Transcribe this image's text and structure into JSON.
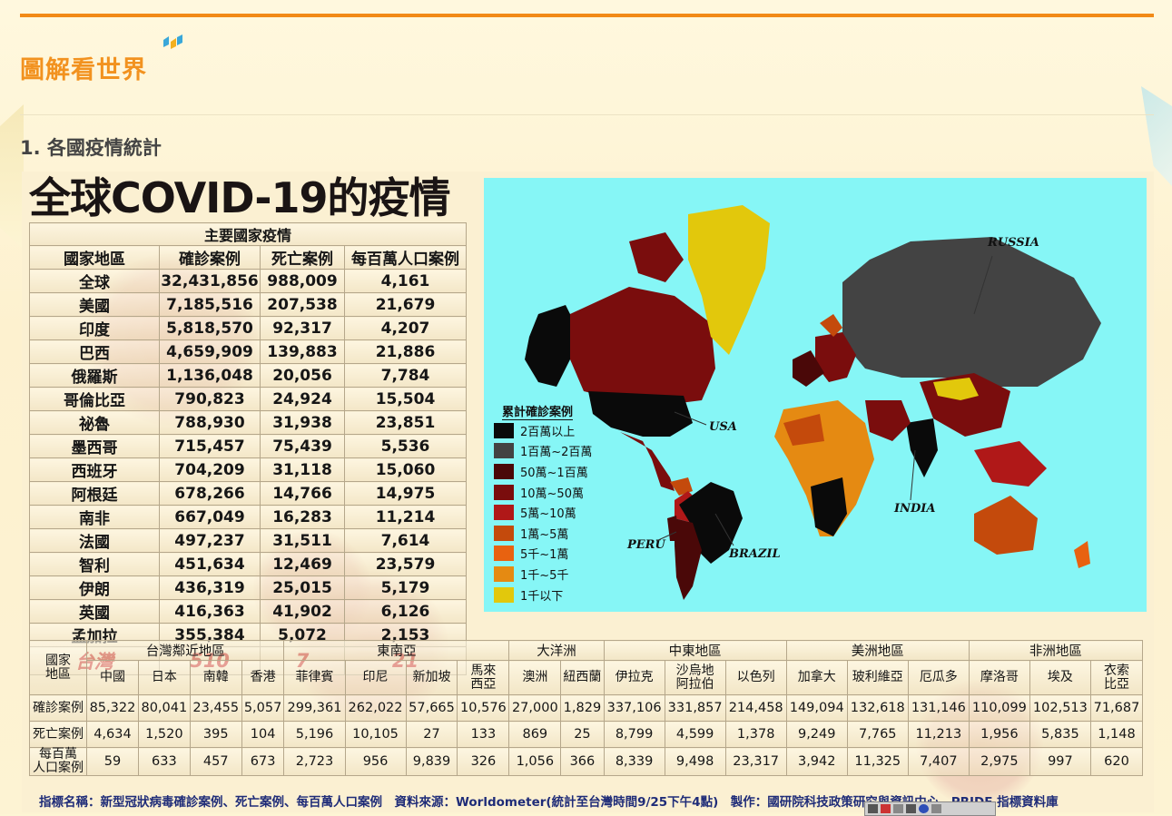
{
  "site": {
    "title": "圖解看世界"
  },
  "section": {
    "title": "1. 各國疫情統計"
  },
  "infographic": {
    "title": "全球COVID-19的疫情",
    "main_table": {
      "group_header": "主要國家疫情",
      "headers": [
        "國家地區",
        "確診案例",
        "死亡案例",
        "每百萬人口案例"
      ],
      "rows": [
        [
          "全球",
          "32,431,856",
          "988,009",
          "4,161"
        ],
        [
          "美國",
          "7,185,516",
          "207,538",
          "21,679"
        ],
        [
          "印度",
          "5,818,570",
          "92,317",
          "4,207"
        ],
        [
          "巴西",
          "4,659,909",
          "139,883",
          "21,886"
        ],
        [
          "俄羅斯",
          "1,136,048",
          "20,056",
          "7,784"
        ],
        [
          "哥倫比亞",
          "790,823",
          "24,924",
          "15,504"
        ],
        [
          "祕魯",
          "788,930",
          "31,938",
          "23,851"
        ],
        [
          "墨西哥",
          "715,457",
          "75,439",
          "5,536"
        ],
        [
          "西班牙",
          "704,209",
          "31,118",
          "15,060"
        ],
        [
          "阿根廷",
          "678,266",
          "14,766",
          "14,975"
        ],
        [
          "南非",
          "667,049",
          "16,283",
          "11,214"
        ],
        [
          "法國",
          "497,237",
          "31,511",
          "7,614"
        ],
        [
          "智利",
          "451,634",
          "12,469",
          "23,579"
        ],
        [
          "伊朗",
          "436,319",
          "25,015",
          "5,179"
        ],
        [
          "英國",
          "416,363",
          "41,902",
          "6,126"
        ],
        [
          "孟加拉",
          "355,384",
          "5,072",
          "2,153"
        ]
      ],
      "highlight_row": [
        "台灣",
        "510",
        "7",
        "21"
      ]
    },
    "map": {
      "legend_title": "累計確診案例",
      "legend": [
        {
          "label": "2百萬以上",
          "color": "#0a0a0a"
        },
        {
          "label": "1百萬~2百萬",
          "color": "#434343"
        },
        {
          "label": "50萬~1百萬",
          "color": "#4a0808"
        },
        {
          "label": "10萬~50萬",
          "color": "#7a0d0d"
        },
        {
          "label": "5萬~10萬",
          "color": "#b01818"
        },
        {
          "label": "1萬~5萬",
          "color": "#c44a0c"
        },
        {
          "label": "5千~1萬",
          "color": "#e86210"
        },
        {
          "label": "1千~5千",
          "color": "#e58a12"
        },
        {
          "label": "1千以下",
          "color": "#e2c80c"
        }
      ],
      "labels": {
        "russia": "RUSSIA",
        "usa": "USA",
        "india": "INDIA",
        "peru": "PERU",
        "brazil": "BRAZIL"
      },
      "colors": {
        "ocean": "#86f6f6",
        "greenland": "#e2c80c"
      }
    },
    "regional_table": {
      "row_label_header": "國家\n地區",
      "regions": [
        {
          "name": "台灣鄰近地區",
          "span": 4
        },
        {
          "name": "東南亞",
          "span": 4
        },
        {
          "name": "大洋洲",
          "span": 2
        },
        {
          "name": "中東地區",
          "span": 3
        },
        {
          "name": "美洲地區",
          "span": 3
        },
        {
          "name": "非洲地區",
          "span": 3
        }
      ],
      "countries": [
        "中國",
        "日本",
        "南韓",
        "香港",
        "菲律賓",
        "印尼",
        "新加坡",
        "馬來\n西亞",
        "澳洲",
        "紐西蘭",
        "伊拉克",
        "沙烏地\n阿拉伯",
        "以色列",
        "加拿大",
        "玻利維亞",
        "厄瓜多",
        "摩洛哥",
        "埃及",
        "衣索\n比亞"
      ],
      "rows": [
        {
          "label": "確診案例",
          "values": [
            "85,322",
            "80,041",
            "23,455",
            "5,057",
            "299,361",
            "262,022",
            "57,665",
            "10,576",
            "27,000",
            "1,829",
            "337,106",
            "331,857",
            "214,458",
            "149,094",
            "132,618",
            "131,146",
            "110,099",
            "102,513",
            "71,687"
          ]
        },
        {
          "label": "死亡案例",
          "values": [
            "4,634",
            "1,520",
            "395",
            "104",
            "5,196",
            "10,105",
            "27",
            "133",
            "869",
            "25",
            "8,799",
            "4,599",
            "1,378",
            "9,249",
            "7,765",
            "11,213",
            "1,956",
            "5,835",
            "1,148"
          ]
        },
        {
          "label": "每百萬\n人口案例",
          "values": [
            "59",
            "633",
            "457",
            "673",
            "2,723",
            "956",
            "9,839",
            "326",
            "1,056",
            "366",
            "8,339",
            "9,498",
            "23,317",
            "3,942",
            "11,325",
            "7,407",
            "2,975",
            "997",
            "620"
          ]
        }
      ]
    },
    "footer": "指標名稱：新型冠狀病毒確診案例、死亡案例、每百萬人口案例　資料來源：Worldometer(統計至台灣時間9/25下午4點)　製作：國研院科技政策研究與資訊中心　PRIDE 指標資料庫"
  }
}
